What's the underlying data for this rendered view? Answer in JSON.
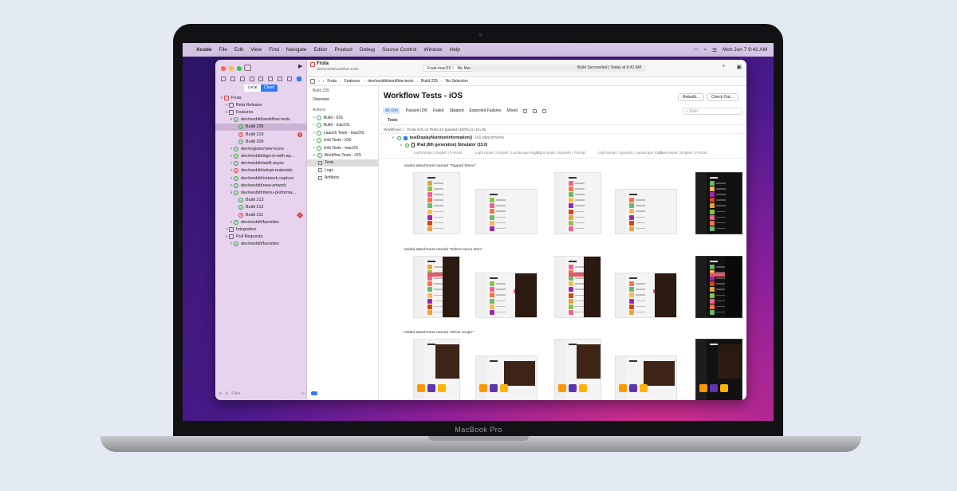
{
  "menubar": {
    "app": "Xcode",
    "items": [
      "File",
      "Edit",
      "View",
      "Find",
      "Navigate",
      "Editor",
      "Product",
      "Debug",
      "Source Control",
      "Window",
      "Help"
    ],
    "datetime": "Mon Jun 7  9:41 AM"
  },
  "sidebar": {
    "seg_local": "Local",
    "seg_cloud": "Cloud",
    "filter_placeholder": "Filter",
    "rows": [
      {
        "label": "Fruta",
        "icon": "proj",
        "chev": "∨",
        "indent": 0
      },
      {
        "label": "Beta Release",
        "icon": "folder",
        "chev": ">",
        "indent": 1
      },
      {
        "label": "Features",
        "icon": "folder",
        "chev": "∨",
        "indent": 1
      },
      {
        "label": "dev/nesbitt/workflow-tests",
        "icon": "pass",
        "chev": "∨",
        "indent": 2
      },
      {
        "label": "Build 235",
        "icon": "pass",
        "chev": "",
        "indent": 3,
        "selected": true
      },
      {
        "label": "Build 210",
        "icon": "fail",
        "chev": "",
        "indent": 3,
        "err": "x"
      },
      {
        "label": "Build 209",
        "icon": "pass",
        "chev": "",
        "indent": 3
      },
      {
        "label": "dev/register/new-icons",
        "icon": "pass",
        "chev": ">",
        "indent": 2
      },
      {
        "label": "dev/nesbitt/sign-in-with-ap...",
        "icon": "pass",
        "chev": ">",
        "indent": 2
      },
      {
        "label": "dev/nesbitt/swift-async",
        "icon": "pass",
        "chev": ">",
        "indent": 2
      },
      {
        "label": "dev/nesbitt/adopt-materials",
        "icon": "fail",
        "chev": ">",
        "indent": 2
      },
      {
        "label": "dev/nesbitt/network-capture",
        "icon": "pass",
        "chev": ">",
        "indent": 2
      },
      {
        "label": "dev/nesbitt/new-artwork",
        "icon": "pass",
        "chev": ">",
        "indent": 2
      },
      {
        "label": "dev/nesbitt/menu-performa...",
        "icon": "pass",
        "chev": "∨",
        "indent": 2
      },
      {
        "label": "Build 213",
        "icon": "pass",
        "chev": "",
        "indent": 3
      },
      {
        "label": "Build 212",
        "icon": "pass",
        "chev": "",
        "indent": 3
      },
      {
        "label": "Build 211",
        "icon": "fail",
        "chev": "",
        "indent": 3,
        "err": "!"
      },
      {
        "label": "dev/nesbitt/favorites",
        "icon": "pass",
        "chev": ">",
        "indent": 2
      },
      {
        "label": "Integration",
        "icon": "folder",
        "chev": ">",
        "indent": 1
      },
      {
        "label": "Pull Requests",
        "icon": "folder",
        "chev": "∨",
        "indent": 1
      },
      {
        "label": "dev/nesbitt/favorites",
        "icon": "pass",
        "chev": ">",
        "indent": 2
      }
    ]
  },
  "toolbar": {
    "project": "Fruta",
    "branch": "dev/nesbitt/workflow-tests",
    "scheme": "Fruta macOS  〉 My Mac",
    "status": "Build Succeeded | Today at 9:41 AM"
  },
  "jumpbar": [
    "Fruta",
    "Features",
    "dev/nesbitt/workflow-tests",
    "Build 235",
    "No Selection"
  ],
  "report_nav": {
    "build": "Build 235",
    "overview": "Overview",
    "actions_header": "Actions",
    "actions": [
      {
        "label": "Build - iOS"
      },
      {
        "label": "Build - macOS"
      },
      {
        "label": "Launch Tests - macOS"
      },
      {
        "label": "Unit Tests - iOS"
      },
      {
        "label": "Unit Tests - macOS"
      },
      {
        "label": "Workflow Tests - iOS"
      }
    ],
    "sub": [
      {
        "label": "Tests",
        "selected": true
      },
      {
        "label": "Logs"
      },
      {
        "label": "Artifacts"
      }
    ]
  },
  "content": {
    "title": "Workflow Tests - iOS",
    "rebuild": "Rebuild...",
    "checkout": "Check Out...",
    "filters": [
      "All (24)",
      "Passed (24)",
      "Failed",
      "Skipped",
      "Expected Failures",
      "Mixed"
    ],
    "filter_placeholder": "Filter",
    "tests_header": "Tests",
    "workflow_path": "Workflows  〉 Fruta iOS UI Tests   24 passed (100%) in 1m 8s",
    "test_name": "testDisplayNutritionInformation()",
    "test_attachments": "160 attachments",
    "device": "iPad (8th generation) Simulator (15.0)",
    "configs": [
      "Light Mode | English | Portrait",
      "Light Mode | English | Landscape Right",
      "Light Mode | Spanish | Portrait",
      "Light Mode | Spanish | Landscape Right",
      "Dark Mode | English | Portrait"
    ],
    "attachments": [
      "Added attachment named \"Tapped Menu\"",
      "Added attachment named \"Select menu item\"",
      "Added attachment named \"Show recipe\""
    ]
  },
  "device_label": "MacBook Pro",
  "colors": {
    "accent": "#2f7bf6",
    "pass": "#2fa43a",
    "fail": "#e0443c",
    "sidebar": "#e7d3ee"
  }
}
